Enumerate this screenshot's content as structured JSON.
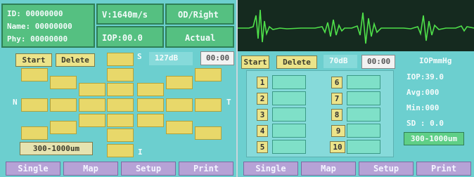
{
  "left": {
    "info": {
      "id": "ID:  00000000",
      "name": "Name: 00000000",
      "phy": "Phy:  00000000"
    },
    "velocity": "V:1640m/s",
    "eye": "OD/Right",
    "iop": "IOP:00.0",
    "mode": "Actual",
    "start_label": "Start",
    "delete_label": "Delete",
    "gain": "127dB",
    "timer": "00:00",
    "dir_s": "S",
    "dir_n": "N",
    "dir_t": "T",
    "dir_i": "I",
    "range": "300-1000um"
  },
  "right": {
    "start_label": "Start",
    "delete_label": "Delete",
    "gain": "70dB",
    "timer": "00:00",
    "unit": "IOPmmHg",
    "iop": "IOP:39.0",
    "avg": "Avg:000",
    "min": "Min:000",
    "sd": "SD : 0.0",
    "range": "300-1000um",
    "slots_left": [
      "1",
      "2",
      "3",
      "4",
      "5"
    ],
    "slots_right": [
      "6",
      "7",
      "8",
      "9",
      "10"
    ]
  },
  "tabs": [
    "Single",
    "Map",
    "Setup",
    "Print"
  ]
}
